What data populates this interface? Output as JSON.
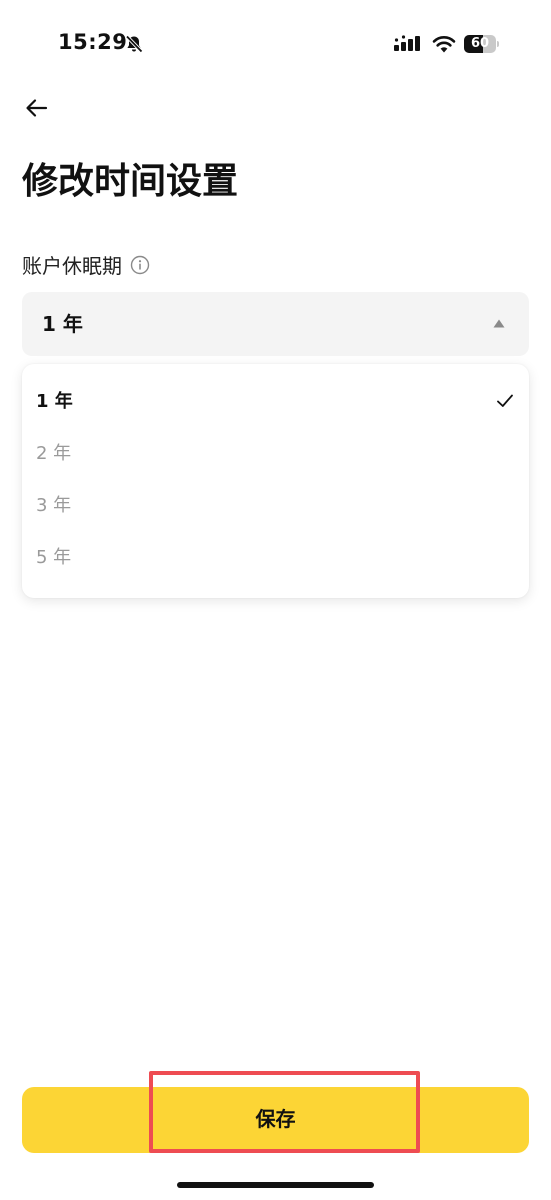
{
  "status_bar": {
    "time": "15:29",
    "battery_level": "60",
    "icons": [
      "bell-slash-icon",
      "signal-icon",
      "wifi-icon",
      "battery-icon"
    ]
  },
  "header": {
    "back_icon": "arrow-left-icon",
    "title": "修改时间设置"
  },
  "field": {
    "label": "账户休眠期",
    "info_icon": "info-circle-icon",
    "selected_value": "1 年"
  },
  "dropdown": {
    "options": [
      {
        "label": "1 年",
        "selected": true
      },
      {
        "label": "2 年",
        "selected": false
      },
      {
        "label": "3 年",
        "selected": false
      },
      {
        "label": "5 年",
        "selected": false
      }
    ]
  },
  "footer": {
    "save_label": "保存"
  },
  "colors": {
    "accent": "#fcd535",
    "highlight": "#ee4c52",
    "field_bg": "#f4f4f4",
    "muted_text": "#9a9a9a"
  }
}
